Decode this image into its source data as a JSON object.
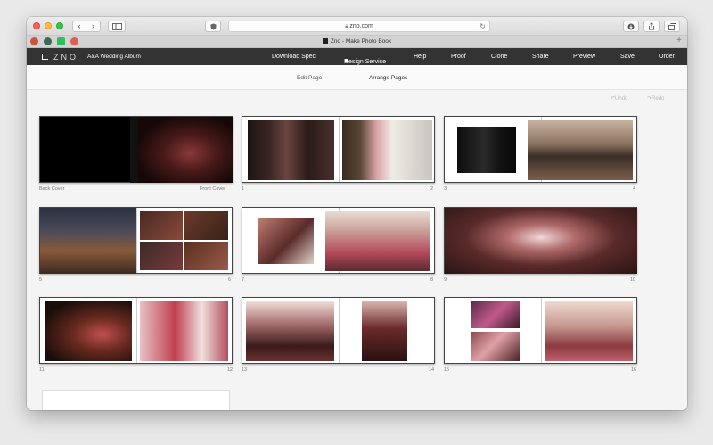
{
  "browser": {
    "url": "zno.com",
    "tab_title": "Zno - Make Photo Book",
    "back_glyph": "‹",
    "forward_glyph": "›",
    "reload_glyph": "↻",
    "plus_glyph": "+"
  },
  "app": {
    "logo_text": "ZNO",
    "album_name": "A&A Wedding Album",
    "nav": [
      "Download Spec",
      "Design Service",
      "Help",
      "Proof",
      "Clone",
      "Share",
      "Preview",
      "Save",
      "Order"
    ]
  },
  "subtabs": {
    "edit": "Edit Page",
    "arrange": "Arrange Pages"
  },
  "history": {
    "undo": "↶Undo",
    "redo": "↷Redo"
  },
  "covers": {
    "back": "Back Cover",
    "front": "Front Cover"
  },
  "pages": [
    "1",
    "2",
    "3",
    "4",
    "5",
    "6",
    "7",
    "8",
    "9",
    "10",
    "11",
    "12",
    "13",
    "14",
    "15",
    "16"
  ],
  "colors": {
    "appbar": "#333333",
    "accent": "#333333"
  }
}
